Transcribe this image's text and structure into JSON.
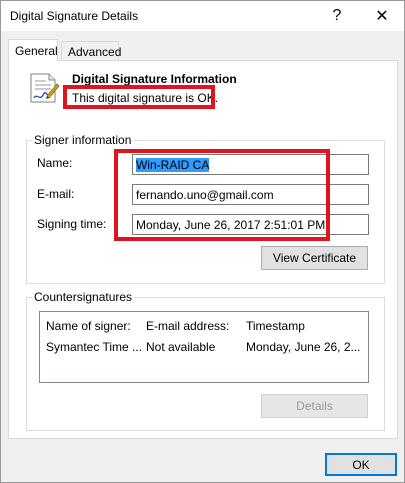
{
  "window": {
    "title": "Digital Signature Details",
    "help_icon_glyph": "?",
    "close_icon_glyph": "✕"
  },
  "tabs": [
    {
      "label": "General",
      "active": true
    },
    {
      "label": "Advanced",
      "active": false
    }
  ],
  "info": {
    "title": "Digital Signature Information",
    "status": "This digital signature is OK."
  },
  "signer": {
    "group_label": "Signer information",
    "name_label": "Name:",
    "name_value": "Win-RAID CA",
    "email_label": "E-mail:",
    "email_value": "fernando.uno@gmail.com",
    "time_label": "Signing time:",
    "time_value": "Monday, June 26, 2017 2:51:01 PM",
    "view_cert_button": "View Certificate"
  },
  "countersignatures": {
    "group_label": "Countersignatures",
    "columns": [
      "Name of signer:",
      "E-mail address:",
      "Timestamp"
    ],
    "rows": [
      [
        "Symantec Time ...",
        "Not available",
        "Monday, June 26, 2..."
      ]
    ],
    "details_button": "Details"
  },
  "footer": {
    "ok_button": "OK"
  },
  "colors": {
    "highlight_red": "#e0141e",
    "selection_blue": "#3399ff",
    "default_button_border": "#0078d7"
  }
}
